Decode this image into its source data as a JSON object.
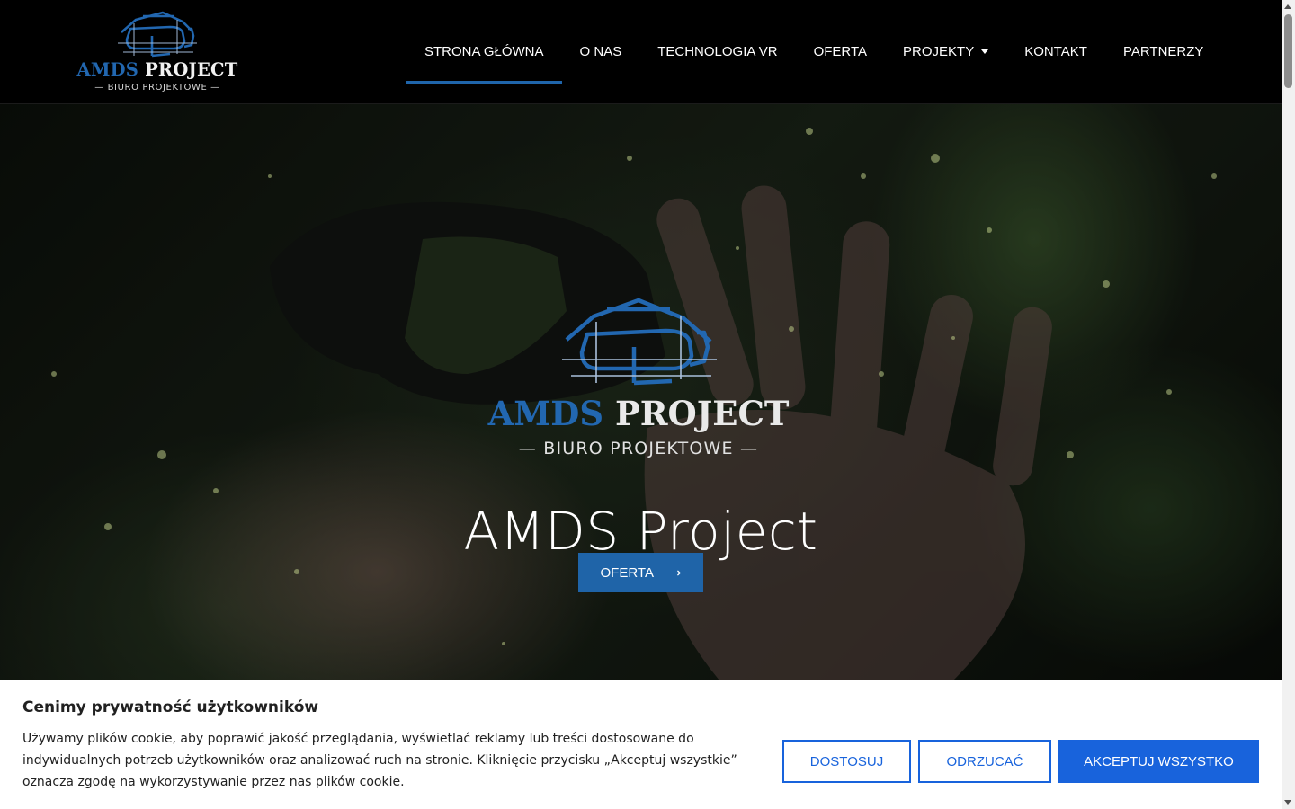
{
  "colors": {
    "accent": "#1f65ab",
    "cookie_accent": "#1863dc",
    "header_bg": "#000000",
    "logo_blue": "#2267b0"
  },
  "header": {
    "logo": {
      "word_part1": "AMDS",
      "word_part2": "PROJECT",
      "subtitle": "BIURO PROJEKTOWE"
    },
    "nav": [
      {
        "label": "STRONA GŁÓWNA",
        "active": true
      },
      {
        "label": "O NAS"
      },
      {
        "label": "TECHNOLOGIA VR"
      },
      {
        "label": "OFERTA"
      },
      {
        "label": "PROJEKTY",
        "icon": "caret-down-icon"
      },
      {
        "label": "KONTAKT"
      },
      {
        "label": "PARTNERZY"
      }
    ]
  },
  "hero": {
    "logo": {
      "word_part1": "AMDS",
      "word_part2": "PROJECT",
      "subtitle": "BIURO PROJEKTOWE"
    },
    "title": "AMDS Project",
    "cta_label": "OFERTA",
    "cta_icon": "arrow-right-icon"
  },
  "cookie_banner": {
    "title": "Cenimy prywatność użytkowników",
    "text": "Używamy plików cookie, aby poprawić jakość przeglądania, wyświetlać reklamy lub treści dostosowane do indywidualnych potrzeb użytkowników oraz analizować ruch na stronie. Kliknięcie przycisku „Akceptuj wszystkie” oznacza zgodę na wykorzystywanie przez nas plików cookie.",
    "customize_label": "DOSTOSUJ",
    "reject_label": "ODRZUCAĆ",
    "accept_label": "AKCEPTUJ WSZYSTKO"
  }
}
